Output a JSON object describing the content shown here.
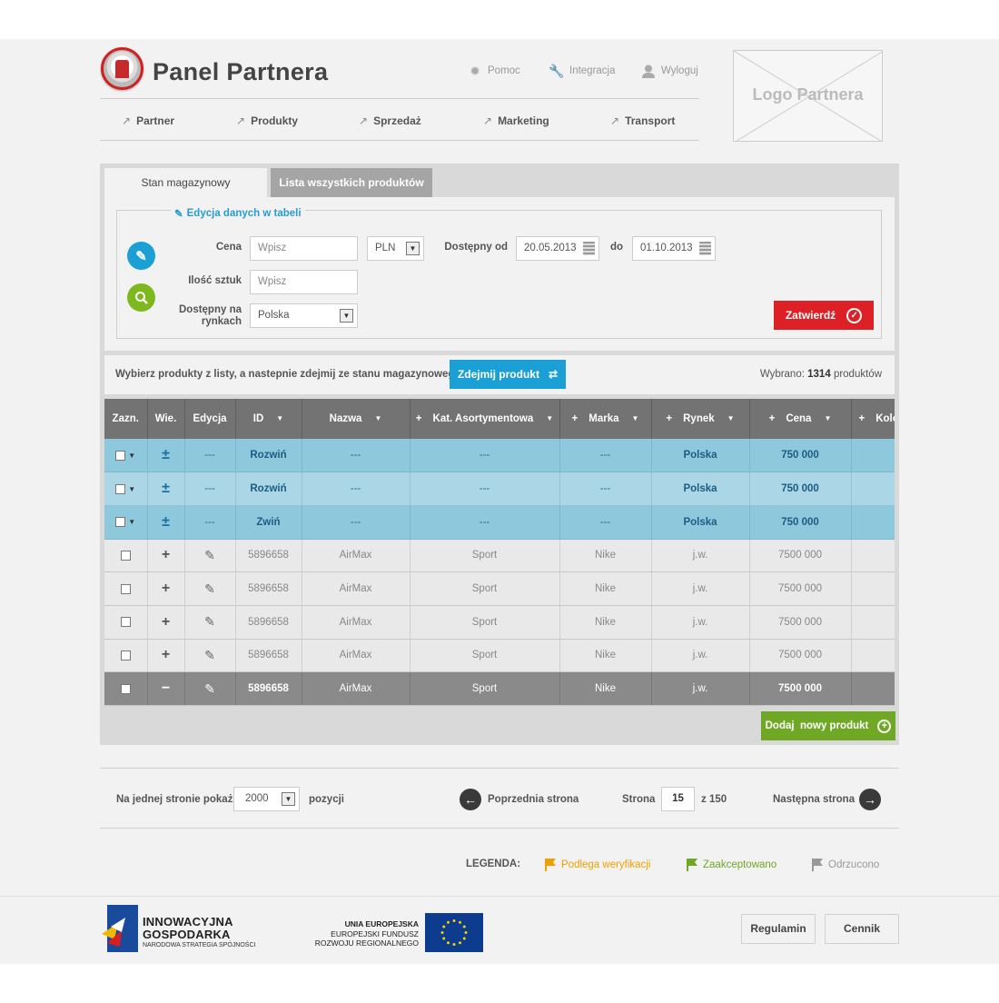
{
  "header": {
    "title": "Panel Partnera",
    "links": [
      {
        "label": "Pomoc",
        "icon": "gear-icon"
      },
      {
        "label": "Integracja",
        "icon": "wrench-icon"
      },
      {
        "label": "Wyloguj",
        "icon": "user-icon"
      }
    ],
    "nav": [
      "Partner",
      "Produkty",
      "Sprzedaż",
      "Marketing",
      "Transport"
    ],
    "partner_logo": "Logo Partnera"
  },
  "tabs": [
    "Stan magazynowy",
    "Lista wszystkich produktów"
  ],
  "filter": {
    "legend": "Edycja danych w tabeli",
    "price_label": "Cena",
    "price_placeholder": "Wpisz",
    "currency": "PLN",
    "qty_label": "Ilość sztuk",
    "qty_placeholder": "Wpisz",
    "markets_label_1": "Dostępny na",
    "markets_label_2": "rynkach",
    "market": "Polska",
    "available_from_label": "Dostępny od",
    "date_from": "20.05.2013",
    "to_label": "do",
    "date_to": "01.10.2013",
    "submit": "Zatwierdź"
  },
  "action": {
    "text": "Wybierz produkty z listy, a nastepnie zdejmij ze stanu magazynowego",
    "button": "Zdejmij produkt",
    "selected_prefix": "Wybrano:",
    "selected_count": "1314",
    "selected_suffix": "produktów"
  },
  "table": {
    "columns": [
      "Zazn.",
      "Wie.",
      "Edycja",
      "ID",
      "Nazwa",
      "Kat. Asortymentowa",
      "Marka",
      "Rynek",
      "Cena",
      "Kolo"
    ],
    "group_rows": [
      {
        "edit": "---",
        "id": "Rozwiń",
        "name": "---",
        "cat": "---",
        "brand": "---",
        "market": "Polska",
        "price": "750 000"
      },
      {
        "edit": "---",
        "id": "Rozwiń",
        "name": "---",
        "cat": "---",
        "brand": "---",
        "market": "Polska",
        "price": "750 000"
      },
      {
        "edit": "---",
        "id": "Zwiń",
        "name": "---",
        "cat": "---",
        "brand": "---",
        "market": "Polska",
        "price": "750 000"
      }
    ],
    "rows": [
      {
        "id": "5896658",
        "name": "AirMax",
        "cat": "Sport",
        "brand": "Nike",
        "market": "j.w.",
        "price": "7500 000"
      },
      {
        "id": "5896658",
        "name": "AirMax",
        "cat": "Sport",
        "brand": "Nike",
        "market": "j.w.",
        "price": "7500 000"
      },
      {
        "id": "5896658",
        "name": "AirMax",
        "cat": "Sport",
        "brand": "Nike",
        "market": "j.w.",
        "price": "7500 000"
      },
      {
        "id": "5896658",
        "name": "AirMax",
        "cat": "Sport",
        "brand": "Nike",
        "market": "j.w.",
        "price": "7500 000"
      },
      {
        "id": "5896658",
        "name": "AirMax",
        "cat": "Sport",
        "brand": "Nike",
        "market": "j.w.",
        "price": "7500 000"
      }
    ]
  },
  "add_button": "Dodaj  nowy produkt",
  "pagination": {
    "per_page_label": "Na jednej stronie pokaż",
    "per_page": "2000",
    "positions": "pozycji",
    "prev": "Poprzednia strona",
    "page_label": "Strona",
    "page": "15",
    "of": "z 150",
    "next": "Następna strona"
  },
  "legend": {
    "title": "LEGENDA:",
    "items": [
      {
        "label": "Podlega weryfikacji",
        "color": "#f0a000"
      },
      {
        "label": "Zaakceptowano",
        "color": "#6ea824"
      },
      {
        "label": "Odrzucono",
        "color": "#999999"
      }
    ]
  },
  "footer": {
    "ig_line1": "INNOWACYJNA",
    "ig_line2": "GOSPODARKA",
    "ig_sub": "NARODOWA STRATEGIA SPÓJNOŚCI",
    "ue_line1": "UNIA EUROPEJSKA",
    "ue_line2": "EUROPEJSKI FUNDUSZ",
    "ue_line3": "ROZWOJU REGIONALNEGO",
    "regulamin": "Regulamin",
    "cennik": "Cennik"
  },
  "colors": {
    "accent_blue": "#1ba0d6",
    "confirm_red": "#dd1f26",
    "add_green": "#6ea824"
  }
}
